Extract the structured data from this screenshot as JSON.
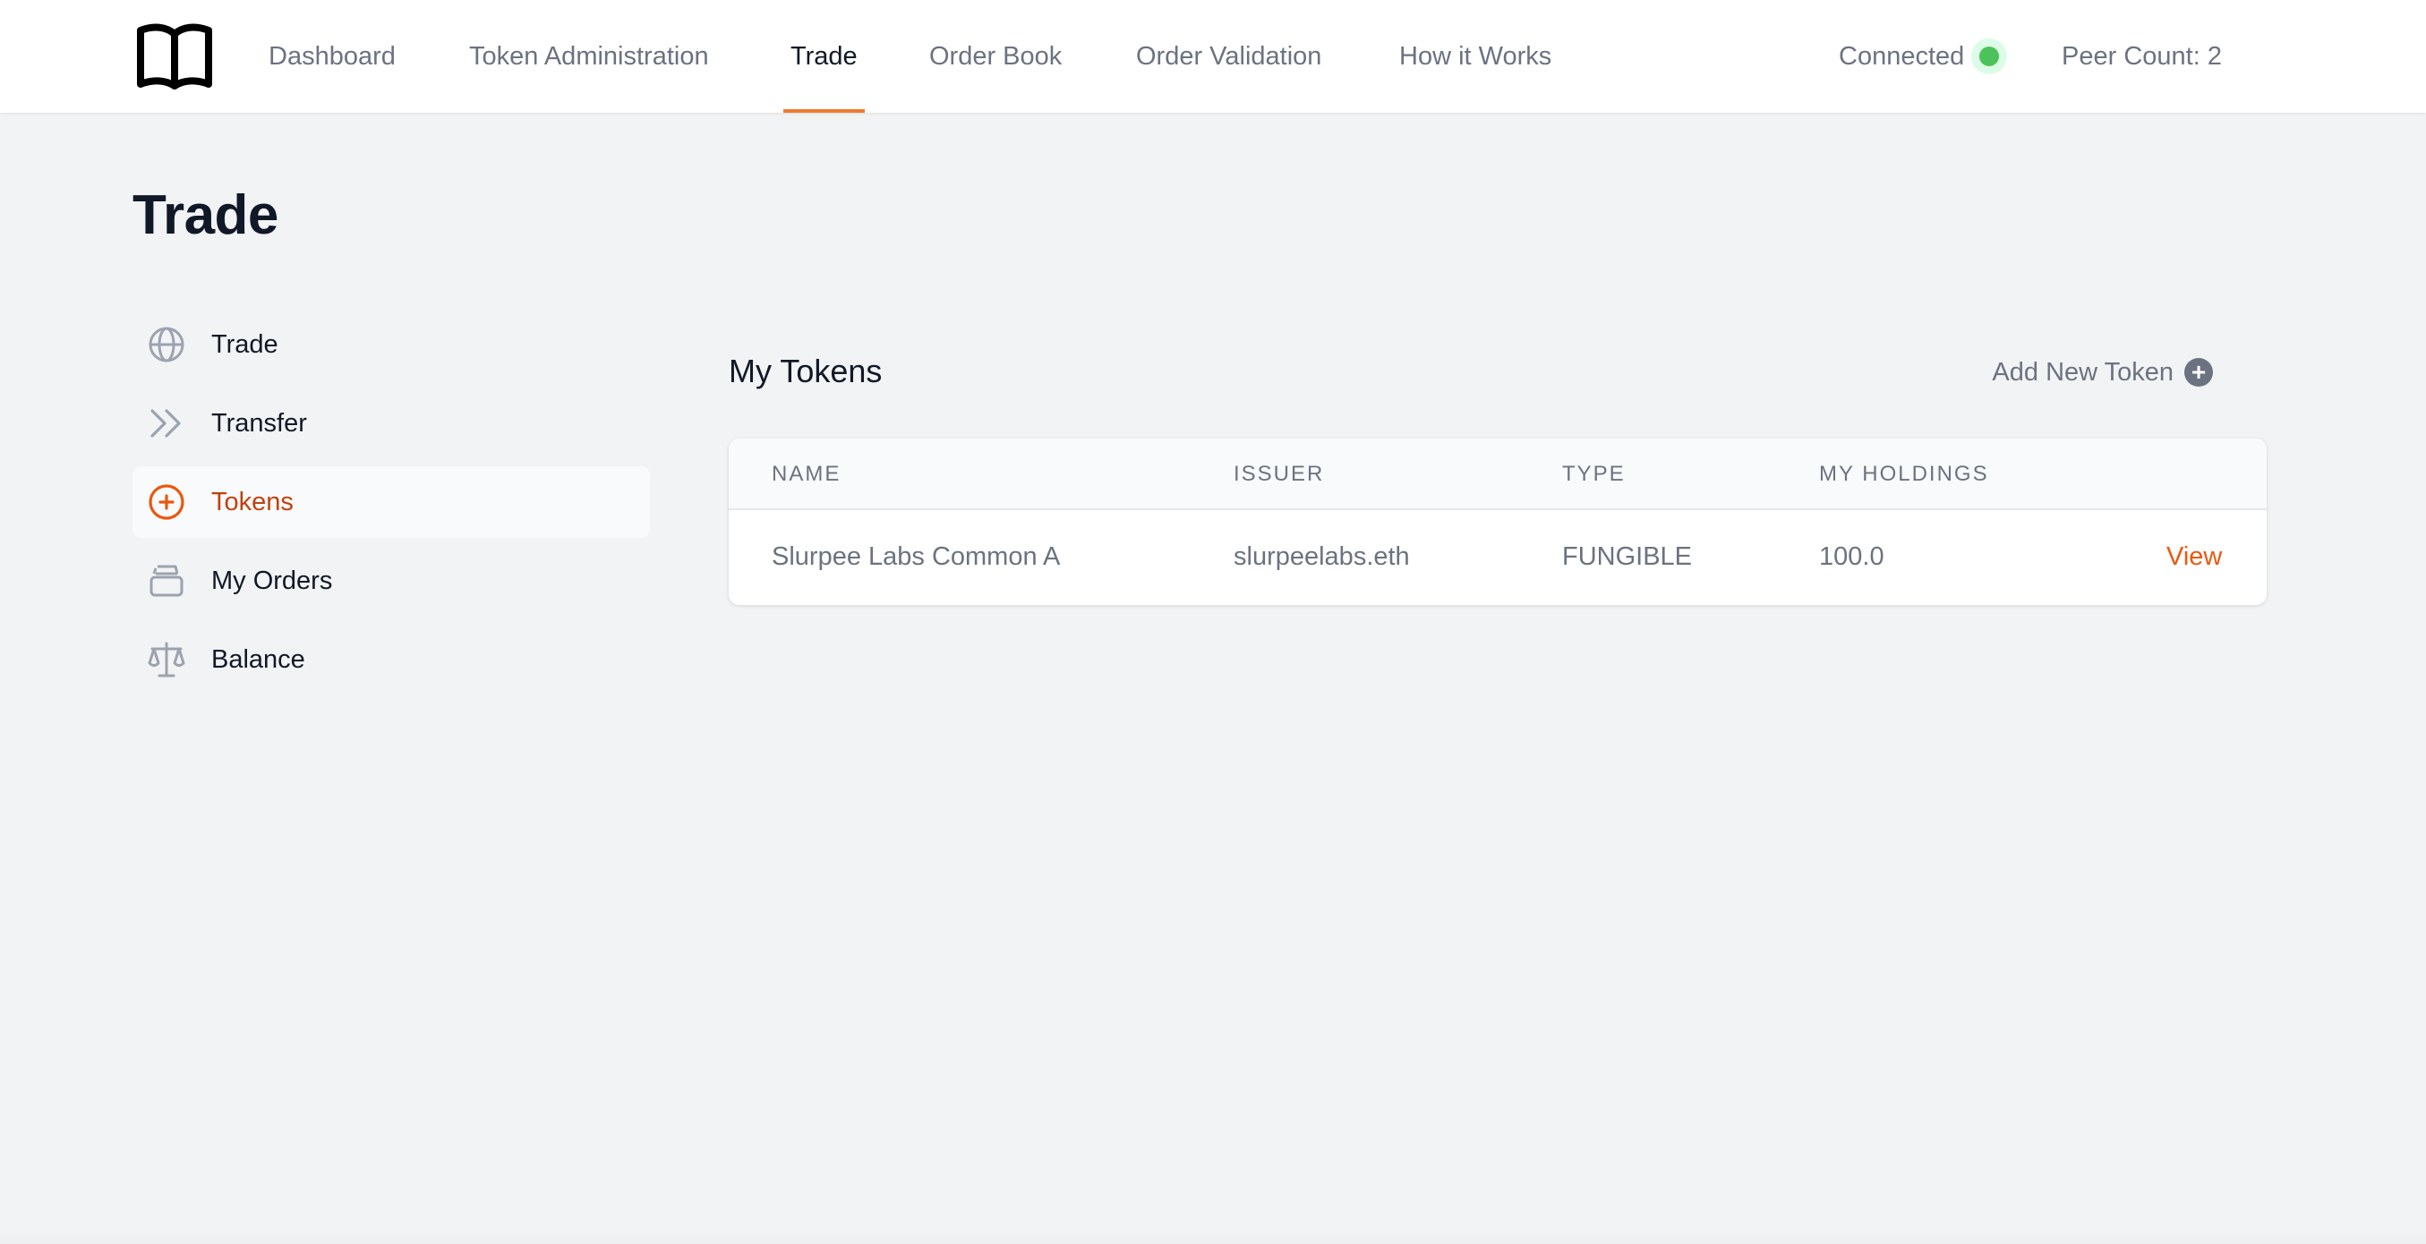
{
  "nav": {
    "tabs": [
      {
        "label": "Dashboard"
      },
      {
        "label": "Token Administration"
      },
      {
        "label": "Trade",
        "active": true
      },
      {
        "label": "Order Book"
      },
      {
        "label": "Order Validation"
      },
      {
        "label": "How it Works"
      }
    ],
    "status": {
      "label": "Connected",
      "indicator_color": "#4cc35a"
    },
    "peer_count": "Peer Count: 2"
  },
  "page": {
    "title": "Trade"
  },
  "sidebar": {
    "items": [
      {
        "label": "Trade",
        "icon": "globe-icon"
      },
      {
        "label": "Transfer",
        "icon": "double-chevron-right-icon"
      },
      {
        "label": "Tokens",
        "icon": "plus-circle-icon",
        "active": true
      },
      {
        "label": "My Orders",
        "icon": "inbox-stack-icon"
      },
      {
        "label": "Balance",
        "icon": "scale-icon"
      }
    ]
  },
  "main": {
    "section_title": "My Tokens",
    "add_button": {
      "label": "Add New Token",
      "icon": "plus-circle-icon"
    },
    "table": {
      "columns": [
        "NAME",
        "ISSUER",
        "TYPE",
        "MY HOLDINGS"
      ],
      "rows": [
        {
          "name": "Slurpee Labs Common A",
          "issuer": "slurpeelabs.eth",
          "type": "FUNGIBLE",
          "holdings": "100.0",
          "action": "View"
        }
      ]
    }
  },
  "colors": {
    "accent": "#ee7a2f",
    "accent_text": "#c2410c",
    "muted": "#6b7280",
    "background": "#f2f3f5"
  }
}
